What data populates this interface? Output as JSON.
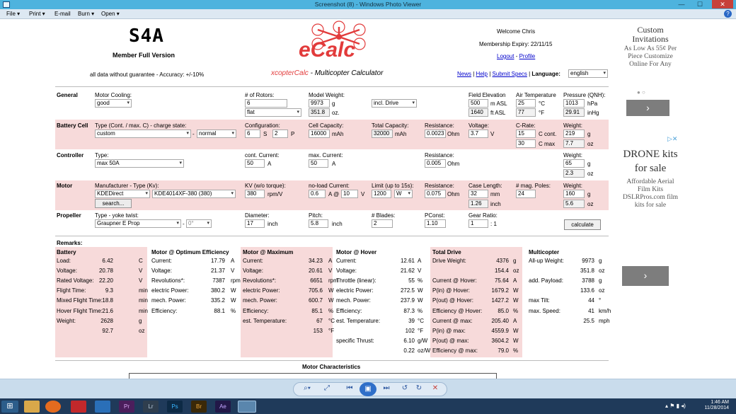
{
  "window": {
    "title": "Screenshot (8) - Windows Photo Viewer"
  },
  "menu": {
    "file": "File",
    "print": "Print",
    "email": "E-mail",
    "burn": "Burn",
    "open": "Open"
  },
  "header": {
    "logo_text": "S4A",
    "member": "Member Full Version",
    "disclaimer": "all data without guarantee - Accuracy: +/-10%",
    "ecalc": "eCalc",
    "app_prefix": "xcopterCalc",
    "app_suffix": " - Multicopter Calculator",
    "welcome": "Welcome Chris",
    "expiry": "Membership Expiry: 22/11/15",
    "logout": "Logout",
    "profile": "Profile",
    "news": "News",
    "help": "Help",
    "submit": "Submit Specs",
    "language_label": "Language:",
    "language": "english"
  },
  "general": {
    "label": "General",
    "cooling_label": "Motor Cooling:",
    "cooling": "good",
    "rotors_label": "# of Rotors:",
    "rotors": "6",
    "frame": "flat",
    "weight_label": "Model Weight:",
    "weight": "9973",
    "weight_unit": "g",
    "weight_oz": "351.8",
    "oz": "oz.",
    "drive": "incl. Drive",
    "elev_label": "Field Elevation",
    "elev": "500",
    "elev_unit": "m ASL",
    "elev_ft": "1640",
    "ft_unit": "ft ASL",
    "temp_label": "Air Temperature",
    "temp_c": "25",
    "c": "°C",
    "temp_f": "77",
    "f": "°F",
    "press_label": "Pressure (QNH):",
    "press": "1013",
    "hpa": "hPa",
    "press_in": "29.91",
    "inhg": "inHg"
  },
  "battery": {
    "label": "Battery Cell",
    "type_label": "Type (Cont. / max. C) - charge state:",
    "type": "custom",
    "state": "normal",
    "dash": "-",
    "config_label": "Configuration:",
    "s": "6",
    "s_lbl": "S",
    "p": "2",
    "p_lbl": "P",
    "cap_label": "Cell Capacity:",
    "cap": "16000",
    "mah": "mAh",
    "tcap_label": "Total Capacity:",
    "tcap": "32000",
    "mah2": "mAh",
    "res_label": "Resistance:",
    "res": "0.0023",
    "ohm": "Ohm",
    "volt_label": "Voltage:",
    "volt": "3.7",
    "v": "V",
    "crate_label": "C-Rate:",
    "cont": "15",
    "cont_lbl": "C cont.",
    "cmax": "30",
    "cmax_lbl": "C max",
    "w_label": "Weight:",
    "w": "219",
    "g": "g",
    "w_oz": "7.7",
    "oz": "oz"
  },
  "controller": {
    "label": "Controller",
    "type_label": "Type:",
    "type": "max 50A",
    "cont_label": "cont. Current:",
    "cont": "50",
    "a": "A",
    "max_label": "max. Current:",
    "max": "50",
    "a2": "A",
    "res_label": "Resistance:",
    "res": "0.005",
    "ohm": "Ohm",
    "w_label": "Weight:",
    "w": "65",
    "g": "g",
    "w_oz": "2.3",
    "oz": "oz"
  },
  "motor": {
    "label": "Motor",
    "man_label": "Manufacturer - Type (Kv):",
    "man": "KDEDirect",
    "model": "KDE4014XF-380 (380)",
    "search": "search...",
    "kv_label": "KV (w/o torque):",
    "kv": "380",
    "rpmv": "rpm/V",
    "nl_label": "no-load Current:",
    "nl": "0.6",
    "a_at": "A @",
    "nlv": "10",
    "v": "V",
    "lim_label": "Limit (up to 15s):",
    "lim": "1200",
    "w_unit": "W",
    "res_label": "Resistance:",
    "res": "0.075",
    "ohm": "Ohm",
    "case_label": "Case Length:",
    "case": "32",
    "mm": "mm",
    "case_in": "1.26",
    "inch": "inch",
    "poles_label": "# mag. Poles:",
    "poles": "24",
    "w_label": "Weight:",
    "w": "160",
    "g": "g",
    "w_oz": "5.6",
    "oz": "oz"
  },
  "propeller": {
    "label": "Propeller",
    "type_label": "Type - yoke twist:",
    "type": "Graupner E Prop",
    "dash": "-",
    "twist": "0°",
    "dia_label": "Diameter:",
    "dia": "17",
    "inch": "inch",
    "pitch_label": "Pitch:",
    "pitch": "5.8",
    "inch2": "inch",
    "blades_label": "# Blades:",
    "blades": "2",
    "pconst_label": "PConst:",
    "pconst": "1.10",
    "gear_label": "Gear Ratio:",
    "gear": "1",
    "gear_suffix": ": 1",
    "calculate": "calculate"
  },
  "remarks": {
    "label": "Remarks:"
  },
  "results": {
    "battery": {
      "title": "Battery",
      "rows": [
        [
          "Load:",
          "6.42",
          "C"
        ],
        [
          "Voltage:",
          "20.78",
          "V"
        ],
        [
          "Rated Voltage:",
          "22.20",
          "V"
        ],
        [
          "Flight Time:",
          "9.3",
          "min"
        ],
        [
          "Mixed Flight Time:",
          "18.8",
          "min"
        ],
        [
          "Hover Flight Time:",
          "21.6",
          "min"
        ],
        [
          "Weight:",
          "2628",
          "g"
        ],
        [
          "",
          "92.7",
          "oz"
        ]
      ]
    },
    "optimum": {
      "title": "Motor @ Optimum Efficiency",
      "rows": [
        [
          "Current:",
          "17.79",
          "A"
        ],
        [
          "Voltage:",
          "21.37",
          "V"
        ],
        [
          "Revolutions*:",
          "7387",
          "rpm"
        ],
        [
          "electric Power:",
          "380.2",
          "W"
        ],
        [
          "mech. Power:",
          "335.2",
          "W"
        ],
        [
          "Efficiency:",
          "88.1",
          "%"
        ]
      ]
    },
    "maximum": {
      "title": "Motor @ Maximum",
      "rows": [
        [
          "Current:",
          "34.23",
          "A"
        ],
        [
          "Voltage:",
          "20.61",
          "V"
        ],
        [
          "Revolutions*:",
          "6651",
          "rpm"
        ],
        [
          "electric Power:",
          "705.6",
          "W"
        ],
        [
          "mech. Power:",
          "600.7",
          "W"
        ],
        [
          "Efficiency:",
          "85.1",
          "%"
        ],
        [
          "est. Temperature:",
          "67",
          "°C"
        ],
        [
          "",
          "153",
          "°F"
        ]
      ]
    },
    "hover": {
      "title": "Motor @ Hover",
      "rows": [
        [
          "Current:",
          "12.61",
          "A"
        ],
        [
          "Voltage:",
          "21.62",
          "V"
        ],
        [
          "Throttle (linear):",
          "55",
          "%"
        ],
        [
          "electric Power:",
          "272.5",
          "W"
        ],
        [
          "mech. Power:",
          "237.9",
          "W"
        ],
        [
          "Efficiency:",
          "87.3",
          "%"
        ],
        [
          "est. Temperature:",
          "39",
          "°C"
        ],
        [
          "",
          "102",
          "°F"
        ],
        [
          "specific Thrust:",
          "6.10",
          "g/W"
        ],
        [
          "",
          "0.22",
          "oz/W"
        ]
      ]
    },
    "total": {
      "title": "Total Drive",
      "rows": [
        [
          "Drive Weight:",
          "4376",
          "g"
        ],
        [
          "",
          "154.4",
          "oz"
        ],
        [
          "Current @ Hover:",
          "75.64",
          "A"
        ],
        [
          "P(in) @ Hover:",
          "1679.2",
          "W"
        ],
        [
          "P(out) @ Hover:",
          "1427.2",
          "W"
        ],
        [
          "Efficiency @ Hover:",
          "85.0",
          "%"
        ],
        [
          "Current @ max:",
          "205.40",
          "A"
        ],
        [
          "P(in) @ max:",
          "4559.9",
          "W"
        ],
        [
          "P(out) @ max:",
          "3604.2",
          "W"
        ],
        [
          "Efficiency @ max:",
          "79.0",
          "%"
        ]
      ]
    },
    "multicopter": {
      "title": "Multicopter",
      "rows": [
        [
          "All-up Weight:",
          "9973",
          "g"
        ],
        [
          "",
          "351.8",
          "oz"
        ],
        [
          "add. Payload:",
          "3788",
          "g"
        ],
        [
          "",
          "133.6",
          "oz"
        ],
        [
          "max Tilt:",
          "44",
          "°"
        ],
        [
          "max. Speed:",
          "41",
          "km/h"
        ],
        [
          "",
          "25.5",
          "mph"
        ]
      ]
    }
  },
  "motor_char": "Motor Characteristics",
  "ads": {
    "ad1_title": "Custom Invitations",
    "ad1_body": "As Low As 55¢ Per Piece Customize Online For Any",
    "ad2_title": "DRONE kits for sale",
    "ad2_body": "Affordable Aerial Film Kits DSLRPros.com film kits for sale",
    "arrow": "›"
  },
  "clock": {
    "time": "1:46 AM",
    "date": "11/28/2014"
  }
}
